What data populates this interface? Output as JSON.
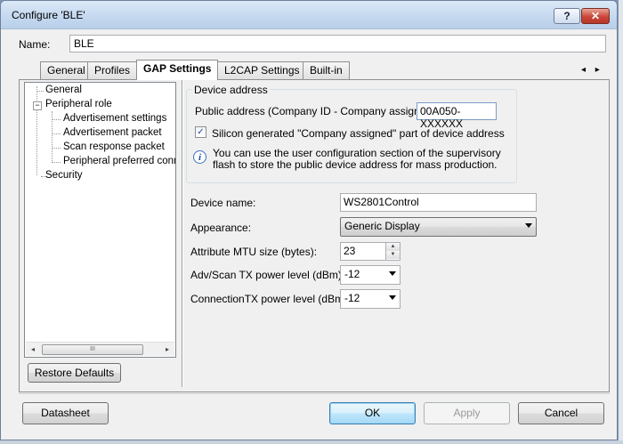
{
  "window": {
    "title": "Configure 'BLE'"
  },
  "titlebar_buttons": {
    "help": "?",
    "close": "✕"
  },
  "name": {
    "label": "Name:",
    "value": "BLE"
  },
  "tabs": [
    {
      "label": "General"
    },
    {
      "label": "Profiles"
    },
    {
      "label": "GAP Settings",
      "active": true
    },
    {
      "label": "L2CAP Settings"
    },
    {
      "label": "Built-in"
    }
  ],
  "tab_scroll": "◂ ▸",
  "tree": {
    "items": [
      {
        "label": "General"
      },
      {
        "label": "Peripheral role"
      },
      {
        "label": "Advertisement settings"
      },
      {
        "label": "Advertisement packet"
      },
      {
        "label": "Scan response packet"
      },
      {
        "label": "Peripheral preferred conne"
      },
      {
        "label": "Security"
      }
    ],
    "expander": "−",
    "scroll_left": "◂",
    "scroll_right": "▸",
    "scroll_thumb": "III"
  },
  "restore_defaults": "Restore Defaults",
  "device_address": {
    "legend": "Device address",
    "public_label": "Public address (Company ID - Company assigned):",
    "public_value": "00A050-XXXXXX",
    "silicon_checked": true,
    "silicon_check_mark": "✓",
    "silicon_label": "Silicon generated \"Company assigned\" part of device address",
    "info_icon": "i",
    "info_text": "You can use the user configuration section of the supervisory flash to store the public device address for mass production."
  },
  "device_name": {
    "label": "Device name:",
    "value": "WS2801Control"
  },
  "appearance": {
    "label": "Appearance:",
    "value": "Generic Display"
  },
  "mtu": {
    "label": "Attribute MTU size (bytes):",
    "value": "23",
    "up": "▲",
    "down": "▼"
  },
  "adv_power": {
    "label": "Adv/Scan TX power level (dBm):",
    "value": "-12"
  },
  "conn_power": {
    "label": "ConnectionTX power level (dBm):",
    "value": "-12"
  },
  "buttons": {
    "datasheet": "Datasheet",
    "ok": "OK",
    "apply": "Apply",
    "cancel": "Cancel"
  }
}
